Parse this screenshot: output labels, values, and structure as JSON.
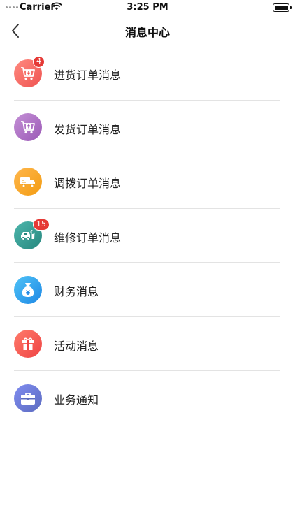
{
  "status_bar": {
    "carrier": "Carrier",
    "time": "3:25 PM"
  },
  "nav": {
    "title": "消息中心",
    "back_icon": "chevron-left-icon"
  },
  "items": [
    {
      "label": "进货订单消息",
      "badge": "4",
      "icon": "cart-download-icon",
      "color_from": "#ff8a80",
      "color_to": "#ef5350"
    },
    {
      "label": "发货订单消息",
      "badge": "",
      "icon": "cart-upload-icon",
      "color_from": "#c490d6",
      "color_to": "#9b59b6"
    },
    {
      "label": "调拨订单消息",
      "badge": "",
      "icon": "truck-icon",
      "color_from": "#ffb74d",
      "color_to": "#f39c12"
    },
    {
      "label": "维修订单消息",
      "badge": "15",
      "icon": "car-wrench-icon",
      "color_from": "#4db6ac",
      "color_to": "#26877e"
    },
    {
      "label": "财务消息",
      "badge": "",
      "icon": "money-bag-icon",
      "color_from": "#4fc3f7",
      "color_to": "#1e88e5"
    },
    {
      "label": "活动消息",
      "badge": "",
      "icon": "gift-icon",
      "color_from": "#ff7b6b",
      "color_to": "#ef4444"
    },
    {
      "label": "业务通知",
      "badge": "",
      "icon": "briefcase-icon",
      "color_from": "#7f8cf0",
      "color_to": "#5c6bc0"
    }
  ]
}
